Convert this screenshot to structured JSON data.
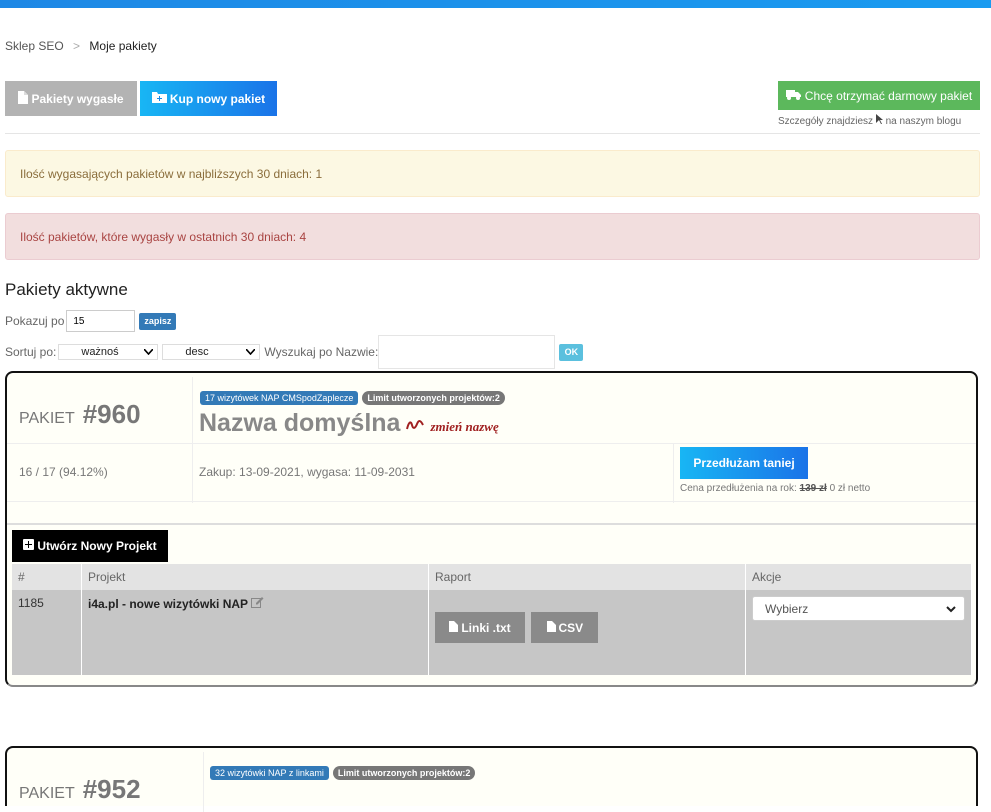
{
  "breadcrumb": {
    "root": "Sklep SEO",
    "current": "Moje pakiety"
  },
  "toolbar": {
    "expired_label": "Pakiety wygasłe",
    "buy_label": "Kup nowy pakiet",
    "free_label": "Chcę otrzymać darmowy pakiet",
    "free_note_prefix": "Szczegóły znajdziesz",
    "free_note_suffix": "na naszym blogu"
  },
  "alerts": {
    "expiring": "Ilość wygasających pakietów w najbliższych 30 dniach: 1",
    "expired": "Ilość pakietów, które wygasły w ostatnich 30 dniach: 4"
  },
  "section_title": "Pakiety aktywne",
  "controls": {
    "show_label": "Pokazuj po",
    "show_value": "15",
    "save_label": "zapisz",
    "sort_label": "Sortuj po:",
    "sort_field": "ważnoś",
    "sort_dir": "desc",
    "search_label": "Wyszukaj po Nazwie:",
    "ok_label": "OK"
  },
  "packages": [
    {
      "label": "PAKIET",
      "number": "#960",
      "badge_type": "17 wizytówek NAP CMSpodZaplecze",
      "badge_limit": "Limit utworzonych projektów:2",
      "name": "Nazwa domyślna",
      "rename_label": "zmień nazwę",
      "usage": "16 / 17 (94.12%)",
      "dates": "Zakup: 13-09-2021, wygasa: 11-09-2031",
      "renew_label": "Przedłużam taniej",
      "renew_price_prefix": "Cena przedłużenia na rok:",
      "renew_old_price": "139 zł",
      "renew_new_price": "0 zł netto",
      "new_project_label": "Utwórz Nowy Projekt",
      "table": {
        "headers": [
          "#",
          "Projekt",
          "Raport",
          "Akcje"
        ],
        "rows": [
          {
            "id": "1185",
            "name": "i4a.pl - nowe wizytówki NAP",
            "report_txt": "Linki .txt",
            "report_csv": "CSV",
            "action": "Wybierz"
          }
        ]
      }
    },
    {
      "label": "PAKIET",
      "number": "#952",
      "badge_type": "32 wizytówki NAP z linkami",
      "badge_limit": "Limit utworzonych projektów:2"
    }
  ]
}
